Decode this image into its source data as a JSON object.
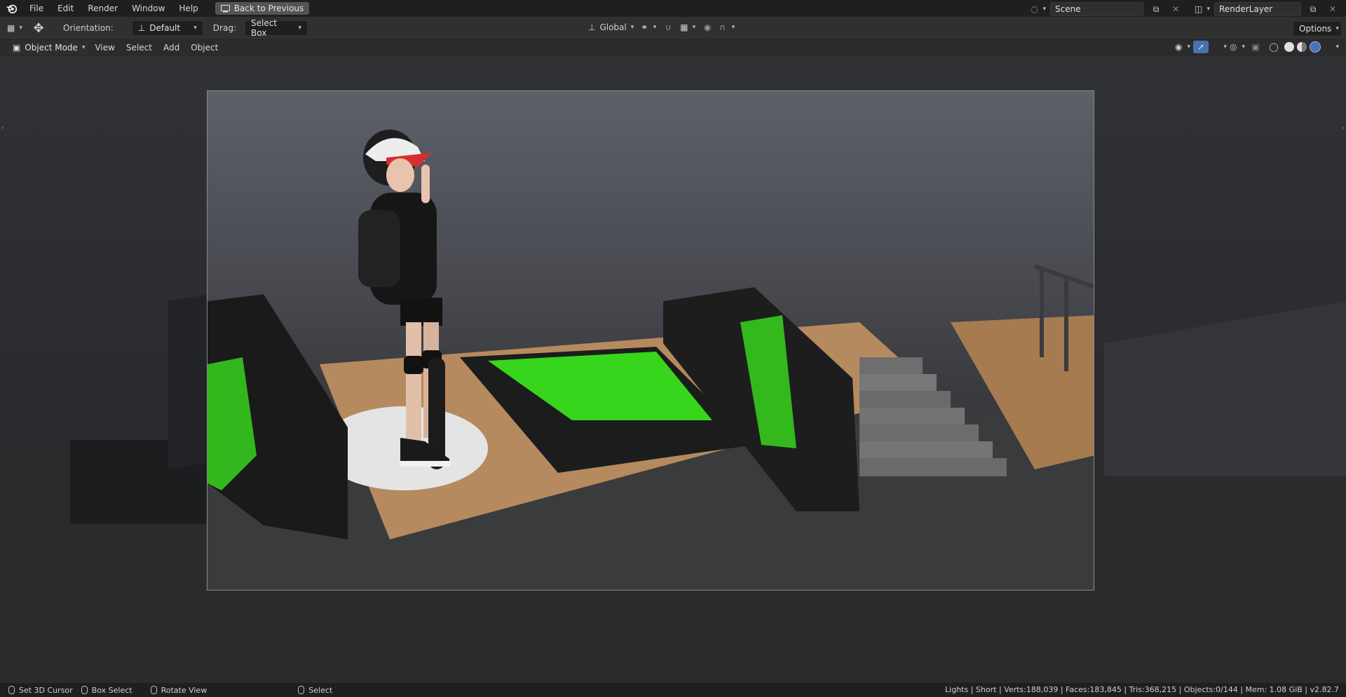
{
  "menu": {
    "items": [
      "File",
      "Edit",
      "Render",
      "Window",
      "Help"
    ],
    "back_button": "Back to Previous"
  },
  "workspace": {
    "scene": "Scene",
    "render_layer": "RenderLayer"
  },
  "toolbar": {
    "orientation_label": "Orientation:",
    "orientation_value": "Default",
    "drag_label": "Drag:",
    "drag_value": "Select Box",
    "transform_orientation": "Global",
    "options_label": "Options"
  },
  "viewport_header": {
    "mode": "Object Mode",
    "menus": [
      "View",
      "Select",
      "Add",
      "Object"
    ]
  },
  "statusbar": {
    "items": [
      "Set 3D Cursor",
      "Box Select",
      "Rotate View",
      "Select"
    ],
    "stats": "Lights | Short | Verts:188,039 | Faces:183,845 | Tris:368,215 | Objects:0/144 | Mem: 1.08 GiB | v2.82.7"
  },
  "colors": {
    "accent": "#4772b3",
    "neon_green": "#37d51c",
    "wood": "#b58a5e"
  }
}
